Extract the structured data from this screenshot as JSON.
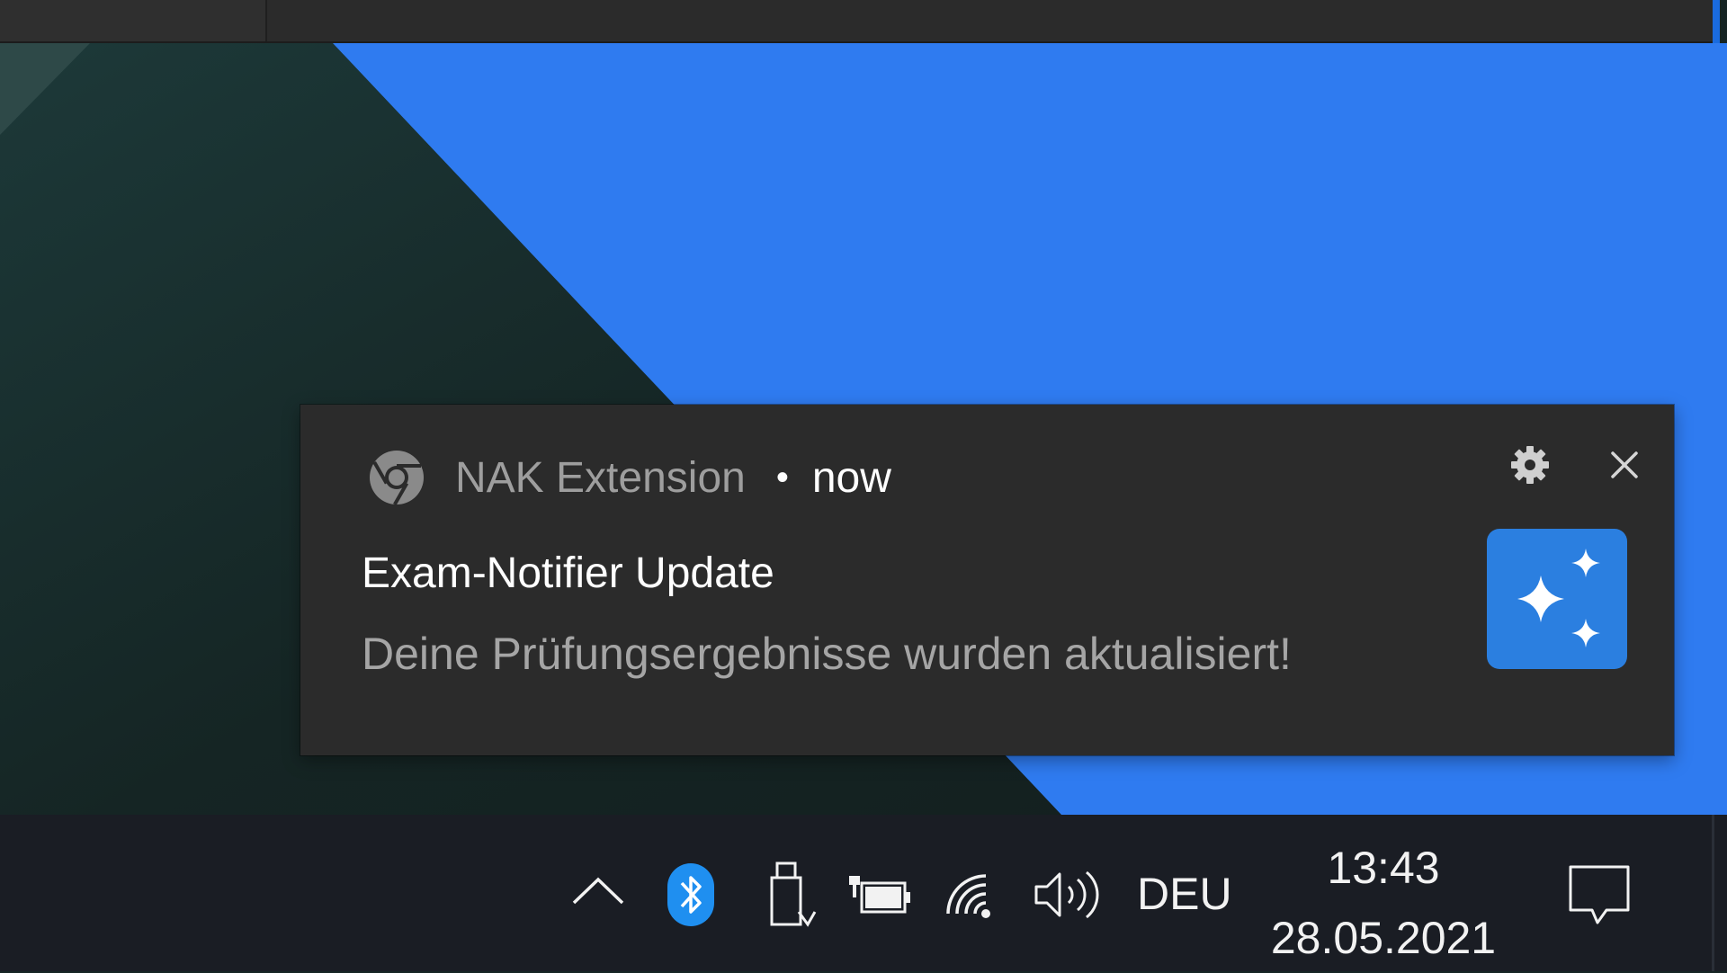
{
  "notification": {
    "app_name": "NAK Extension",
    "separator": "•",
    "time": "now",
    "title": "Exam-Notifier Update",
    "body": "Deine Prüfungsergebnisse wurden aktualisiert!",
    "app_icon": "chrome-icon",
    "hero_icon": "sparkles-icon",
    "hero_color": "#2b7fe0"
  },
  "taskbar": {
    "tray_icons": [
      "chevron-up-icon",
      "bluetooth-icon",
      "usb-icon",
      "power-plug-icon",
      "wifi-icon",
      "volume-icon",
      "action-center-icon"
    ],
    "language": "DEU",
    "time": "13:43",
    "date": "28.05.2021"
  },
  "colors": {
    "wallpaper_blue": "#2f7bf0",
    "wallpaper_dark": "#162524",
    "toast_bg": "#2b2b2b",
    "taskbar_bg": "#1a1d24"
  }
}
